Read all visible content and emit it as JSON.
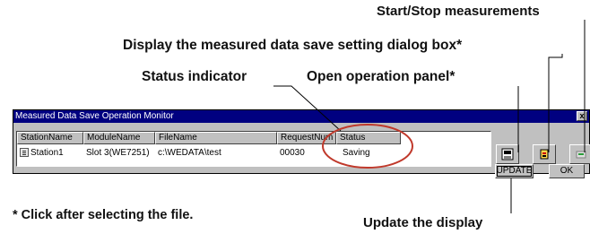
{
  "callouts": {
    "start_stop": "Start/Stop measurements",
    "display_dialog": "Display the measured data save setting dialog box*",
    "status_indicator": "Status indicator",
    "open_panel": "Open operation panel*",
    "click_note": "* Click after selecting the file.",
    "update_display": "Update the display"
  },
  "window": {
    "title": "Measured Data Save Operation Monitor",
    "close_label": "x",
    "columns": [
      "StationName",
      "ModuleName",
      "FileName",
      "RequestNum",
      "Status"
    ],
    "rows": [
      {
        "station": "Station1",
        "module": "Slot 3(WE7251)",
        "file": "c:\\WEDATA\\test",
        "request": "00030",
        "status": "Saving"
      }
    ],
    "buttons": {
      "update": "UPDATE",
      "ok": "OK"
    }
  },
  "icons": [
    "save-settings-icon",
    "operation-panel-icon",
    "start-stop-icon"
  ],
  "colors": {
    "title_bar": "#000080",
    "highlight_ellipse": "#c0392b"
  }
}
